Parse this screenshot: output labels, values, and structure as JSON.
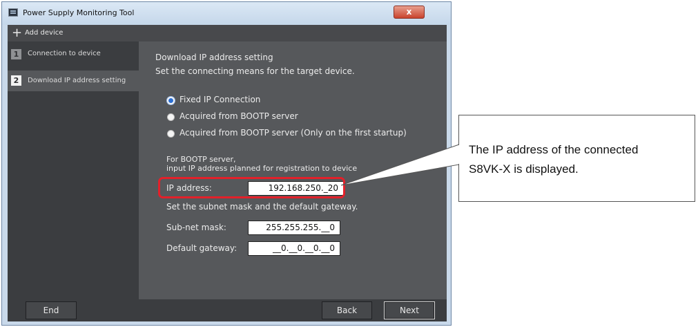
{
  "window": {
    "title": "Power Supply Monitoring Tool",
    "close_symbol": "x"
  },
  "header": {
    "add_icon": "plus-icon",
    "add_label": "Add device"
  },
  "sidebar": {
    "items": [
      {
        "number": "1",
        "label": "Connection to device",
        "active": false
      },
      {
        "number": "2",
        "label": "Download IP address setting",
        "active": true
      }
    ]
  },
  "main": {
    "heading": "Download IP address setting",
    "description": "Set the connecting means for the target device.",
    "options": [
      {
        "label": "Fixed IP Connection",
        "selected": true
      },
      {
        "label": "Acquired from BOOTP server",
        "selected": false
      },
      {
        "label": "Acquired from BOOTP server (Only on the first startup)",
        "selected": false
      }
    ],
    "bootp_note_line1": "For BOOTP server,",
    "bootp_note_line2": "input IP address planned for registration to device",
    "ip_label": "IP address:",
    "ip_value": "192.168.250._20",
    "subnet_note": "Set the subnet mask and the default gateway.",
    "subnet_label": "Sub-net mask:",
    "subnet_value": "255.255.255.__0",
    "gateway_label": "Default gateway:",
    "gateway_value": "__0.__0.__0.__0"
  },
  "footer": {
    "end_label": "End",
    "back_label": "Back",
    "next_label": "Next"
  },
  "callout": {
    "line1": "The IP address of the connected",
    "line2": "S8VK-X is displayed."
  },
  "colors": {
    "highlight": "#e3202a",
    "selected_radio": "#2b6fd4"
  }
}
